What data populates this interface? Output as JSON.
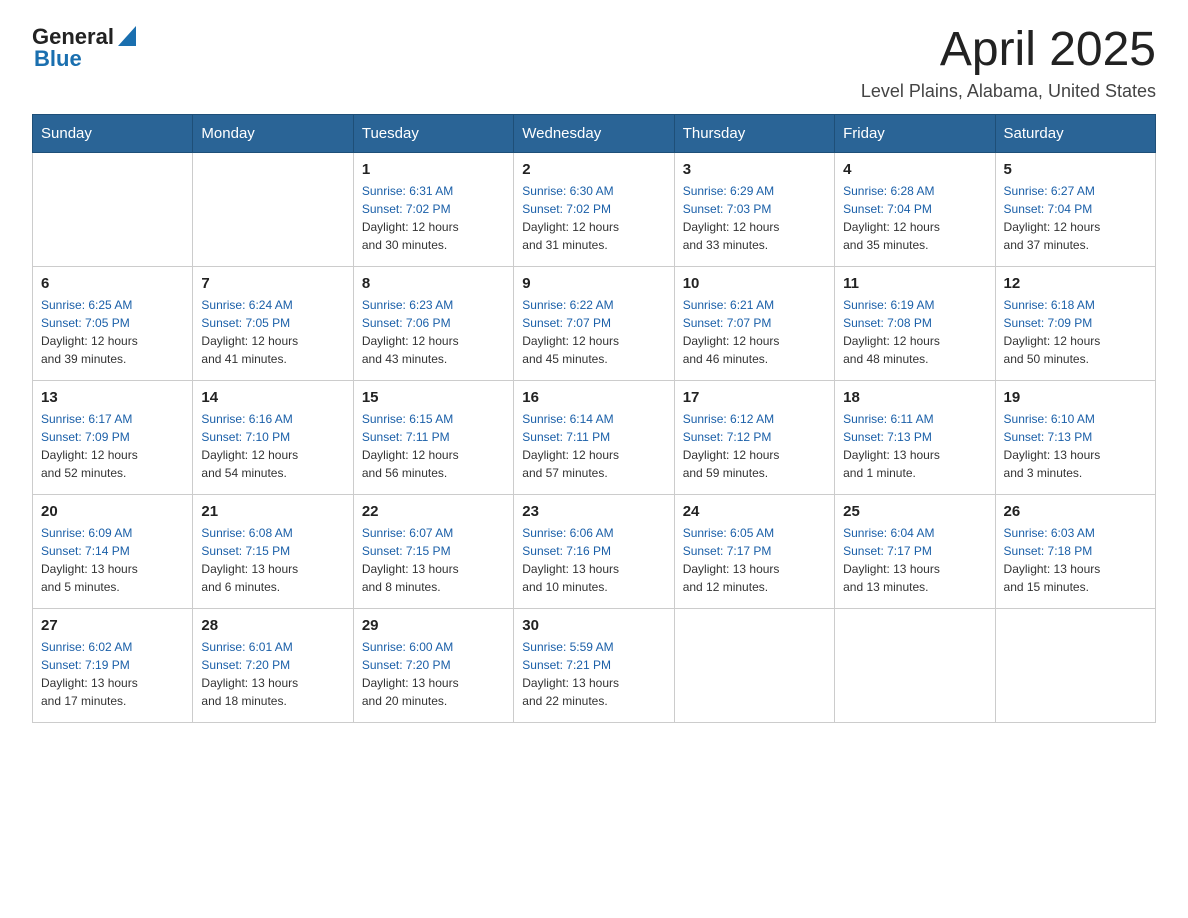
{
  "header": {
    "logo_general": "General",
    "logo_blue": "Blue",
    "title": "April 2025",
    "subtitle": "Level Plains, Alabama, United States"
  },
  "calendar": {
    "weekdays": [
      "Sunday",
      "Monday",
      "Tuesday",
      "Wednesday",
      "Thursday",
      "Friday",
      "Saturday"
    ],
    "weeks": [
      [
        {
          "day": "",
          "info": ""
        },
        {
          "day": "",
          "info": ""
        },
        {
          "day": "1",
          "info": "Sunrise: 6:31 AM\nSunset: 7:02 PM\nDaylight: 12 hours\nand 30 minutes."
        },
        {
          "day": "2",
          "info": "Sunrise: 6:30 AM\nSunset: 7:02 PM\nDaylight: 12 hours\nand 31 minutes."
        },
        {
          "day": "3",
          "info": "Sunrise: 6:29 AM\nSunset: 7:03 PM\nDaylight: 12 hours\nand 33 minutes."
        },
        {
          "day": "4",
          "info": "Sunrise: 6:28 AM\nSunset: 7:04 PM\nDaylight: 12 hours\nand 35 minutes."
        },
        {
          "day": "5",
          "info": "Sunrise: 6:27 AM\nSunset: 7:04 PM\nDaylight: 12 hours\nand 37 minutes."
        }
      ],
      [
        {
          "day": "6",
          "info": "Sunrise: 6:25 AM\nSunset: 7:05 PM\nDaylight: 12 hours\nand 39 minutes."
        },
        {
          "day": "7",
          "info": "Sunrise: 6:24 AM\nSunset: 7:05 PM\nDaylight: 12 hours\nand 41 minutes."
        },
        {
          "day": "8",
          "info": "Sunrise: 6:23 AM\nSunset: 7:06 PM\nDaylight: 12 hours\nand 43 minutes."
        },
        {
          "day": "9",
          "info": "Sunrise: 6:22 AM\nSunset: 7:07 PM\nDaylight: 12 hours\nand 45 minutes."
        },
        {
          "day": "10",
          "info": "Sunrise: 6:21 AM\nSunset: 7:07 PM\nDaylight: 12 hours\nand 46 minutes."
        },
        {
          "day": "11",
          "info": "Sunrise: 6:19 AM\nSunset: 7:08 PM\nDaylight: 12 hours\nand 48 minutes."
        },
        {
          "day": "12",
          "info": "Sunrise: 6:18 AM\nSunset: 7:09 PM\nDaylight: 12 hours\nand 50 minutes."
        }
      ],
      [
        {
          "day": "13",
          "info": "Sunrise: 6:17 AM\nSunset: 7:09 PM\nDaylight: 12 hours\nand 52 minutes."
        },
        {
          "day": "14",
          "info": "Sunrise: 6:16 AM\nSunset: 7:10 PM\nDaylight: 12 hours\nand 54 minutes."
        },
        {
          "day": "15",
          "info": "Sunrise: 6:15 AM\nSunset: 7:11 PM\nDaylight: 12 hours\nand 56 minutes."
        },
        {
          "day": "16",
          "info": "Sunrise: 6:14 AM\nSunset: 7:11 PM\nDaylight: 12 hours\nand 57 minutes."
        },
        {
          "day": "17",
          "info": "Sunrise: 6:12 AM\nSunset: 7:12 PM\nDaylight: 12 hours\nand 59 minutes."
        },
        {
          "day": "18",
          "info": "Sunrise: 6:11 AM\nSunset: 7:13 PM\nDaylight: 13 hours\nand 1 minute."
        },
        {
          "day": "19",
          "info": "Sunrise: 6:10 AM\nSunset: 7:13 PM\nDaylight: 13 hours\nand 3 minutes."
        }
      ],
      [
        {
          "day": "20",
          "info": "Sunrise: 6:09 AM\nSunset: 7:14 PM\nDaylight: 13 hours\nand 5 minutes."
        },
        {
          "day": "21",
          "info": "Sunrise: 6:08 AM\nSunset: 7:15 PM\nDaylight: 13 hours\nand 6 minutes."
        },
        {
          "day": "22",
          "info": "Sunrise: 6:07 AM\nSunset: 7:15 PM\nDaylight: 13 hours\nand 8 minutes."
        },
        {
          "day": "23",
          "info": "Sunrise: 6:06 AM\nSunset: 7:16 PM\nDaylight: 13 hours\nand 10 minutes."
        },
        {
          "day": "24",
          "info": "Sunrise: 6:05 AM\nSunset: 7:17 PM\nDaylight: 13 hours\nand 12 minutes."
        },
        {
          "day": "25",
          "info": "Sunrise: 6:04 AM\nSunset: 7:17 PM\nDaylight: 13 hours\nand 13 minutes."
        },
        {
          "day": "26",
          "info": "Sunrise: 6:03 AM\nSunset: 7:18 PM\nDaylight: 13 hours\nand 15 minutes."
        }
      ],
      [
        {
          "day": "27",
          "info": "Sunrise: 6:02 AM\nSunset: 7:19 PM\nDaylight: 13 hours\nand 17 minutes."
        },
        {
          "day": "28",
          "info": "Sunrise: 6:01 AM\nSunset: 7:20 PM\nDaylight: 13 hours\nand 18 minutes."
        },
        {
          "day": "29",
          "info": "Sunrise: 6:00 AM\nSunset: 7:20 PM\nDaylight: 13 hours\nand 20 minutes."
        },
        {
          "day": "30",
          "info": "Sunrise: 5:59 AM\nSunset: 7:21 PM\nDaylight: 13 hours\nand 22 minutes."
        },
        {
          "day": "",
          "info": ""
        },
        {
          "day": "",
          "info": ""
        },
        {
          "day": "",
          "info": ""
        }
      ]
    ]
  }
}
